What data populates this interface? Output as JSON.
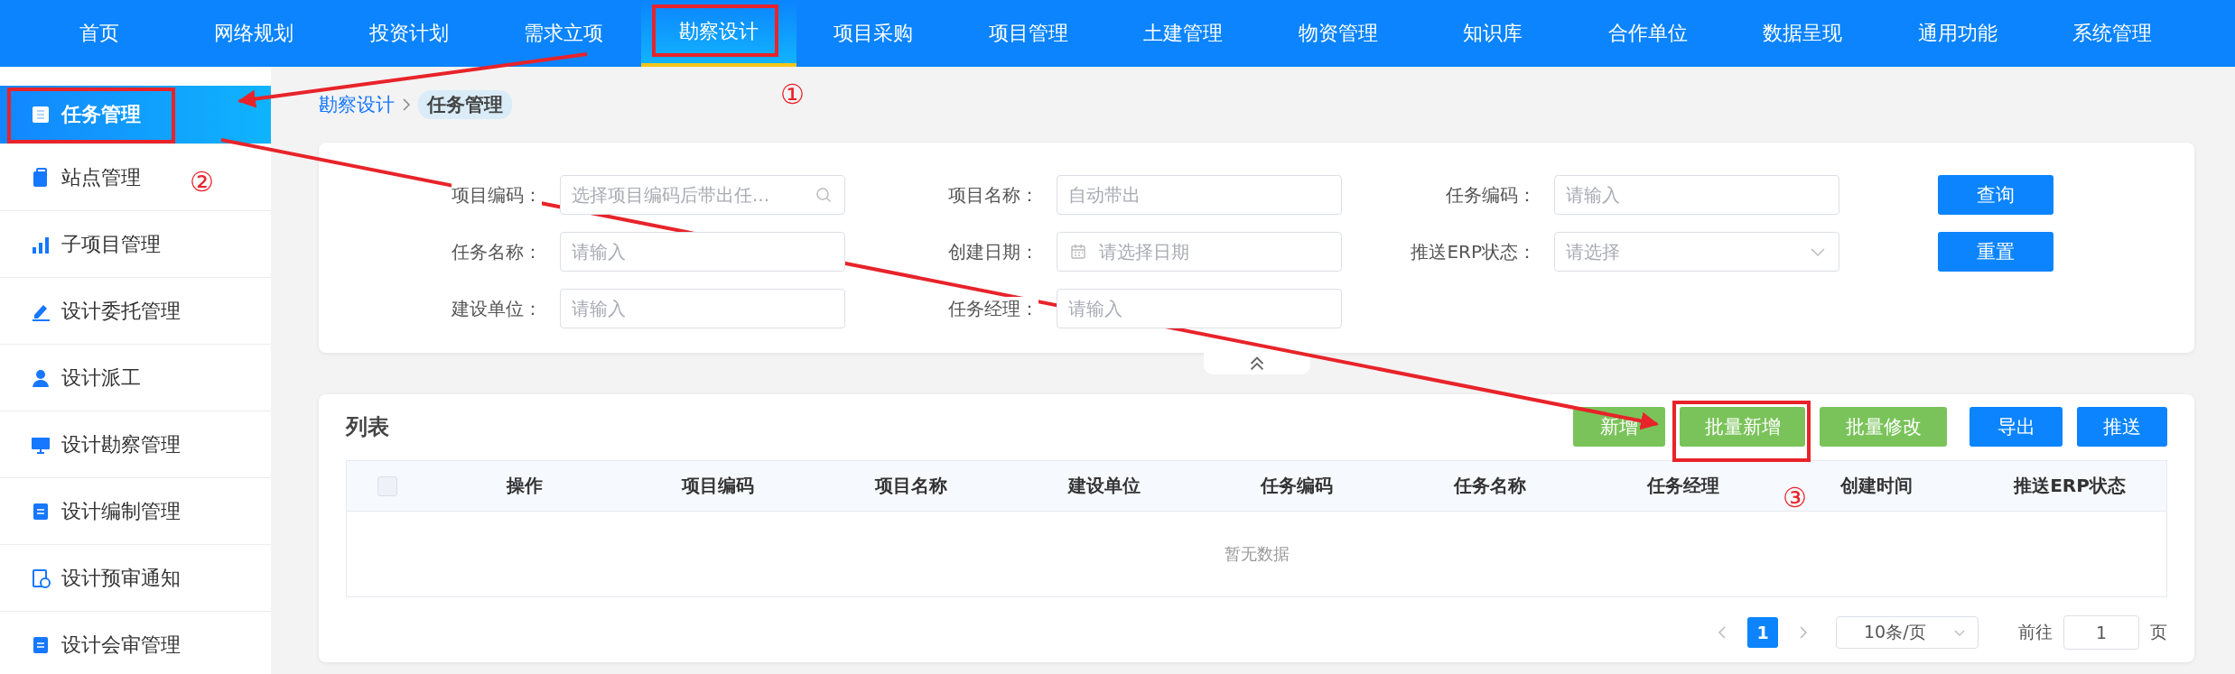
{
  "nav": [
    {
      "label": "首页",
      "selected": false,
      "red_box": false
    },
    {
      "label": "网络规划",
      "selected": false,
      "red_box": false
    },
    {
      "label": "投资计划",
      "selected": false,
      "red_box": false
    },
    {
      "label": "需求立项",
      "selected": false,
      "red_box": false
    },
    {
      "label": "勘察设计",
      "selected": true,
      "red_box": true,
      "callout": "①"
    },
    {
      "label": "项目采购",
      "selected": false,
      "red_box": false
    },
    {
      "label": "项目管理",
      "selected": false,
      "red_box": false
    },
    {
      "label": "土建管理",
      "selected": false,
      "red_box": false
    },
    {
      "label": "物资管理",
      "selected": false,
      "red_box": false
    },
    {
      "label": "知识库",
      "selected": false,
      "red_box": false
    },
    {
      "label": "合作单位",
      "selected": false,
      "red_box": false
    },
    {
      "label": "数据呈现",
      "selected": false,
      "red_box": false
    },
    {
      "label": "通用功能",
      "selected": false,
      "red_box": false
    },
    {
      "label": "系统管理",
      "selected": false,
      "red_box": false
    }
  ],
  "sidebar": {
    "items": [
      {
        "label": "任务管理",
        "selected": true,
        "red_box": true,
        "callout": "②"
      },
      {
        "label": "站点管理",
        "selected": false,
        "red_box": false
      },
      {
        "label": "子项目管理",
        "selected": false,
        "red_box": false
      },
      {
        "label": "设计委托管理",
        "selected": false,
        "red_box": false
      },
      {
        "label": "设计派工",
        "selected": false,
        "red_box": false
      },
      {
        "label": "设计勘察管理",
        "selected": false,
        "red_box": false
      },
      {
        "label": "设计编制管理",
        "selected": false,
        "red_box": false
      },
      {
        "label": "设计预审通知",
        "selected": false,
        "red_box": false
      },
      {
        "label": "设计会审管理",
        "selected": false,
        "red_box": false
      }
    ]
  },
  "breadcrumb": {
    "link": "勘察设计",
    "current": "任务管理"
  },
  "filters": {
    "fields": [
      {
        "label": "项目编码：",
        "placeholder": "选择项目编码后带出任...",
        "kind": "search"
      },
      {
        "label": "项目名称：",
        "placeholder": "自动带出",
        "kind": "text"
      },
      {
        "label": "任务编码：",
        "placeholder": "请输入",
        "kind": "text"
      },
      {
        "label": "任务名称：",
        "placeholder": "请输入",
        "kind": "text"
      },
      {
        "label": "创建日期：",
        "placeholder": "请选择日期",
        "kind": "date"
      },
      {
        "label": "推送ERP状态：",
        "placeholder": "请选择",
        "kind": "select"
      },
      {
        "label": "建设单位：",
        "placeholder": "请输入",
        "kind": "text"
      },
      {
        "label": "任务经理：",
        "placeholder": "请输入",
        "kind": "text"
      }
    ],
    "buttons": [
      "查询",
      "重置"
    ]
  },
  "list": {
    "title": "列表",
    "buttons": [
      {
        "label": "新增",
        "kind": "success",
        "red_box": false
      },
      {
        "label": "批量新增",
        "kind": "success",
        "red_box": true,
        "callout": "③"
      },
      {
        "label": "批量修改",
        "kind": "success",
        "red_box": false
      },
      {
        "label": "导出",
        "kind": "primary",
        "red_box": false
      },
      {
        "label": "推送",
        "kind": "primary",
        "red_box": false
      }
    ],
    "select_all": {
      "checked": false
    },
    "columns": [
      "操作",
      "项目编码",
      "项目名称",
      "建设单位",
      "任务编码",
      "任务名称",
      "任务经理",
      "创建时间",
      "推送ERP状态"
    ],
    "empty_text": "暂无数据"
  },
  "pagination": {
    "pages": [
      {
        "label": "1",
        "selected": true
      }
    ],
    "page_size": "10条/页",
    "goto_label": "前往",
    "goto_value": "1",
    "page_unit": "页"
  }
}
